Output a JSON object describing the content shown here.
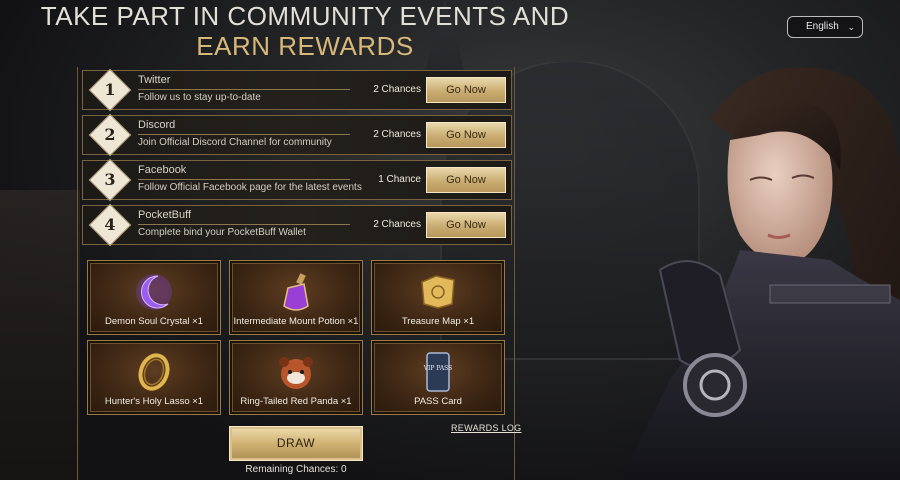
{
  "heading": {
    "line1": "TAKE PART IN COMMUNITY EVENTS AND",
    "line2": "EARN REWARDS"
  },
  "language": {
    "selected": "English",
    "icon": "chevron-down-icon"
  },
  "tasks": [
    {
      "number": "1",
      "title": "Twitter",
      "description": "Follow us to stay up-to-date",
      "chances": "2 Chances",
      "button": "Go Now"
    },
    {
      "number": "2",
      "title": "Discord",
      "description": "Join Official Discord Channel for community",
      "chances": "2 Chances",
      "button": "Go Now"
    },
    {
      "number": "3",
      "title": "Facebook",
      "description": "Follow Official Facebook page for the latest events",
      "chances": "1 Chance",
      "button": "Go Now"
    },
    {
      "number": "4",
      "title": "PocketBuff",
      "description": "Complete bind your PocketBuff Wallet",
      "chances": "2 Chances",
      "button": "Go Now"
    }
  ],
  "rewards": [
    {
      "label": "Demon Soul Crystal ×1",
      "icon": "crescent-crystal-icon"
    },
    {
      "label": "Intermediate Mount Potion ×1",
      "icon": "potion-flask-icon"
    },
    {
      "label": "Treasure Map ×1",
      "icon": "treasure-map-icon"
    },
    {
      "label": "Hunter's Holy Lasso ×1",
      "icon": "golden-lasso-icon"
    },
    {
      "label": "Ring-Tailed Red Panda ×1",
      "icon": "red-panda-icon"
    },
    {
      "label": "PASS Card",
      "icon": "pass-card-icon",
      "card_text": "VIP PASS"
    }
  ],
  "rewards_log": "REWARDS LOG",
  "draw_button": "DRAW",
  "remaining": "Remaining Chances: 0",
  "colors": {
    "gold": "#d8b77a",
    "button": "#c9ad72",
    "panel_border": "#7a6440"
  }
}
